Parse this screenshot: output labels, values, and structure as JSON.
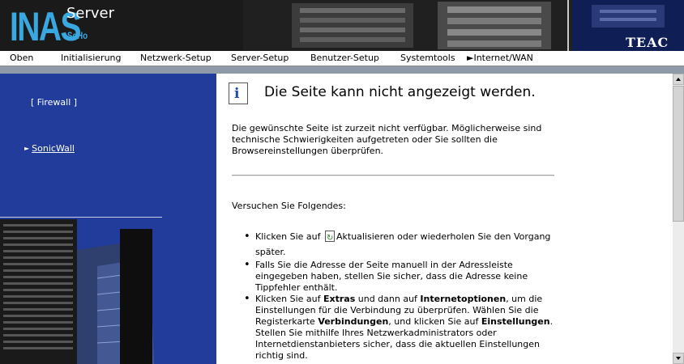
{
  "header": {
    "logo_main": "INAS",
    "logo_sub": "Server",
    "logo_edition": "SoHo",
    "brand": "TEAC"
  },
  "nav": {
    "items": [
      "Oben",
      "Initialisierung",
      "Netzwerk-Setup",
      "Server-Setup",
      "Benutzer-Setup",
      "Systemtools",
      "►Internet/WAN"
    ]
  },
  "sidebar": {
    "firewall_label": "[ Firewall ]",
    "sonicwall_label": "SonicWall"
  },
  "content": {
    "title": "Die Seite kann nicht angezeigt werden.",
    "description": "Die gewünschte Seite ist zurzeit nicht verfügbar. Möglicherweise sind technische Schwierigkeiten aufgetreten oder Sie sollten die Browsereinstellungen überprüfen.",
    "try_label": "Versuchen Sie Folgendes:",
    "suggestion1_pre": "Klicken Sie auf",
    "suggestion1_post": "Aktualisieren oder wiederholen Sie den Vorgang später.",
    "suggestion2": "Falls Sie die Adresse der Seite manuell in der Adressleiste eingegeben haben, stellen Sie sicher, dass die Adresse keine Tippfehler enthält.",
    "s3_a": "Klicken Sie auf ",
    "s3_b": "Extras",
    "s3_c": " und dann auf ",
    "s3_d": "Internetoptionen",
    "s3_e": ", um die Einstellungen für die Verbindung zu überprüfen. Wählen Sie die Registerkarte ",
    "s3_f": "Verbindungen",
    "s3_g": ", und klicken Sie auf ",
    "s3_h": "Einstellungen",
    "s3_i": ". Stellen Sie mithilfe Ihres Netzwerkadministrators oder Internetdienstanbieters sicher, dass die aktuellen Einstellungen richtig sind."
  },
  "colors": {
    "sidebar_bg": "#213c9a",
    "header_bg": "#1a1a1a",
    "logo_accent": "#3aa8e0",
    "info_icon": "#1d4ea6"
  },
  "icons": {
    "info": "info-icon",
    "refresh": "refresh-icon",
    "scroll_up": "scroll-up-arrow-icon",
    "scroll_down": "scroll-down-arrow-icon"
  }
}
